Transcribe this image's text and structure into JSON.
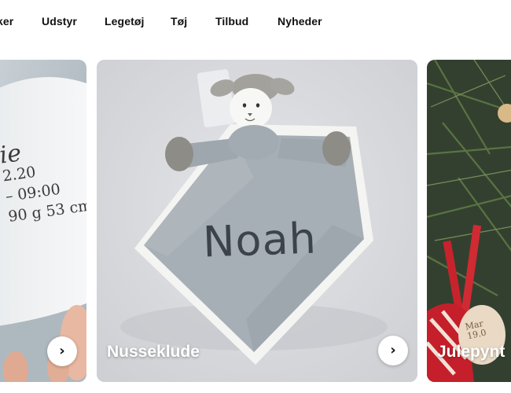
{
  "nav": {
    "items": [
      {
        "label": "ker"
      },
      {
        "label": "Udstyr"
      },
      {
        "label": "Legetøj"
      },
      {
        "label": "Tøj"
      },
      {
        "label": "Tilbud"
      },
      {
        "label": "Nyheder"
      }
    ]
  },
  "cards": [
    {
      "title": "",
      "photo_text": [
        "ie",
        "2.20",
        "– 09:00",
        "90 g  53 cm"
      ],
      "arrow_icon": "chevron-right-icon"
    },
    {
      "title": "Nusseklude",
      "embroidery": "Noah",
      "arrow_icon": "chevron-right-icon"
    },
    {
      "title": "Julepynt",
      "tag_text": "Mar\n19.0",
      "arrow_icon": "chevron-right-icon"
    }
  ],
  "colors": {
    "nav_text": "#111111",
    "card_title": "#ffffff",
    "blanket_grey": "#a7afb6",
    "ribbon_red": "#c8232c"
  }
}
